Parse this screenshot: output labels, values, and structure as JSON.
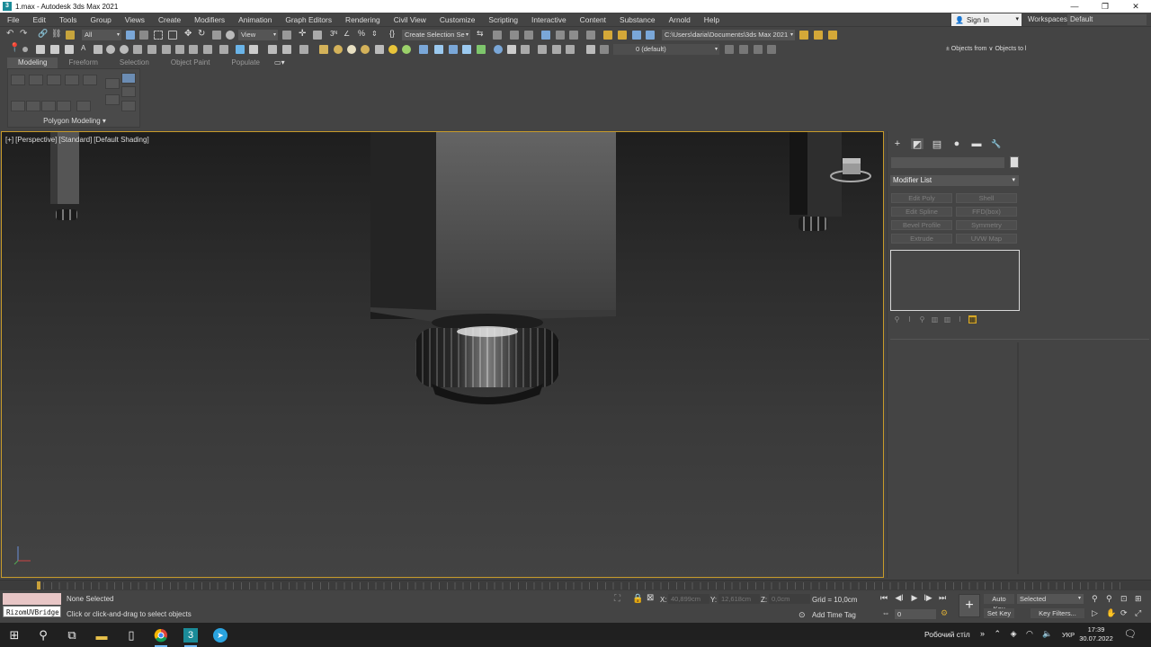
{
  "window": {
    "title": "1.max - Autodesk 3ds Max 2021",
    "app_icon_letter": "3",
    "controls": [
      "—",
      "❐",
      "✕"
    ]
  },
  "menu": {
    "items": [
      "File",
      "Edit",
      "Tools",
      "Group",
      "Views",
      "Create",
      "Modifiers",
      "Animation",
      "Graph Editors",
      "Rendering",
      "Civil View",
      "Customize",
      "Scripting",
      "Interactive",
      "Content",
      "Substance",
      "Arnold",
      "Help"
    ],
    "sign_in": "Sign In",
    "workspaces_label": "Workspaces:",
    "workspaces_value": "Default"
  },
  "toolbar": {
    "selection_filter": "All",
    "ref_coord": "View",
    "named_selection": "Create Selection Se",
    "project_path": "C:\\Users\\daria\\Documents\\3ds Max 2021",
    "layer": "0 (default)",
    "scene_explorer_hint": "± Objects from ∨ Objects to l"
  },
  "ribbon": {
    "tabs": [
      "Modeling",
      "Freeform",
      "Selection",
      "Object Paint",
      "Populate"
    ],
    "panel_label": "Polygon Modeling ▾"
  },
  "viewport": {
    "label_parts": [
      "[+]",
      "[Perspective]",
      "[Standard]",
      "[Default Shading]"
    ]
  },
  "command_panel": {
    "tabs": [
      "+",
      "◩",
      "▤",
      "●",
      "▬",
      "🔧"
    ],
    "modifier_list": "Modifier List",
    "modifier_buttons": [
      [
        "Edit Poly",
        "Shell"
      ],
      [
        "Edit Spline",
        "FFD(box)"
      ],
      [
        "Bevel Profile",
        "Symmetry"
      ],
      [
        "Extrude",
        "UVW Map"
      ]
    ]
  },
  "status": {
    "maxscript_text": "RizomUVBridge",
    "selection": "None Selected",
    "prompt": "Click or click-and-drag to select objects",
    "x_label": "X:",
    "x_value": "40,899cm",
    "y_label": "Y:",
    "y_value": "12,618cm",
    "z_label": "Z:",
    "z_value": "0,0cm",
    "grid": "Grid = 10,0cm",
    "add_time_tag": "Add Time Tag",
    "frame": "0",
    "auto_key": "Auto Key",
    "set_key": "Set Key",
    "selected": "Selected",
    "key_filters": "Key Filters..."
  },
  "taskbar": {
    "desktop_label": "Робочий стіл",
    "language": "УКР",
    "time": "17:39",
    "date": "30.07.2022"
  }
}
